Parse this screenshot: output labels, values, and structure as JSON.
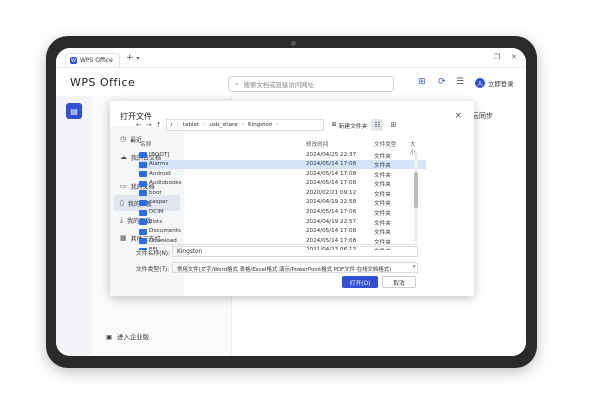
{
  "browser": {
    "tab_title": "WPS Office",
    "tab_logo": "W",
    "new_tab": "+",
    "new_tab_menu": "▾"
  },
  "header": {
    "brand": "WPS Office",
    "search_placeholder": "搜索文档或直接访问网址",
    "user_label": "立即登录",
    "user_avatar": "人"
  },
  "nav": {
    "enterprise_label": "进入企业版"
  },
  "main": {
    "cloud_sync_partial": "云同步"
  },
  "dialog": {
    "title": "打开文件",
    "close": "×",
    "sidebar": [
      {
        "label": "最近",
        "icon": "clock-icon",
        "glyph": "◷"
      },
      {
        "label": "我的云文档",
        "icon": "cloud-icon",
        "glyph": "☁"
      },
      {
        "label": "我的文档",
        "icon": "folder-icon",
        "glyph": "▭"
      },
      {
        "label": "我的平板",
        "icon": "tablet-icon",
        "glyph": "▯"
      },
      {
        "label": "我的下载",
        "icon": "download-icon",
        "glyph": "⤓"
      },
      {
        "label": "其他三方打…",
        "icon": "apps-icon",
        "glyph": "▦"
      }
    ],
    "path": [
      "/",
      "tablet",
      "usb_share",
      "Kingston"
    ],
    "new_folder": "新建文件夹",
    "columns": {
      "name": "名称",
      "modified": "修改时间",
      "type": "文件类型",
      "size": "大小"
    },
    "files": [
      {
        "name": "[BOOT]",
        "modified": "2024/04/25 22:37",
        "type": "文件夹"
      },
      {
        "name": "Alarms",
        "modified": "2024/05/14 17:08",
        "type": "文件夹"
      },
      {
        "name": "Android",
        "modified": "2024/05/14 17:08",
        "type": "文件夹"
      },
      {
        "name": "Audiobooks",
        "modified": "2024/05/14 17:08",
        "type": "文件夹"
      },
      {
        "name": "boot",
        "modified": "2020/02/21 09:12",
        "type": "文件夹"
      },
      {
        "name": "casper",
        "modified": "2024/04/19 22:58",
        "type": "文件夹"
      },
      {
        "name": "DCIM",
        "modified": "2024/05/14 17:08",
        "type": "文件夹"
      },
      {
        "name": "dists",
        "modified": "2024/04/19 22:57",
        "type": "文件夹"
      },
      {
        "name": "Documents",
        "modified": "2024/05/14 17:08",
        "type": "文件夹"
      },
      {
        "name": "Download",
        "modified": "2024/05/14 17:08",
        "type": "文件夹"
      },
      {
        "name": "EFI",
        "modified": "2021/04/23 06:12",
        "type": "文件夹"
      }
    ],
    "selected_index": 1,
    "filename_label": "文件名称(N):",
    "filename_value": "Kingston",
    "filetype_label": "文件类型(T):",
    "filetype_value": "常用文件(文字/Word格式 表格/Excel格式 演示/PowerPoint格式 PDF文件 在线文档格式)",
    "open_label": "打开(O)",
    "cancel_label": "取消"
  }
}
